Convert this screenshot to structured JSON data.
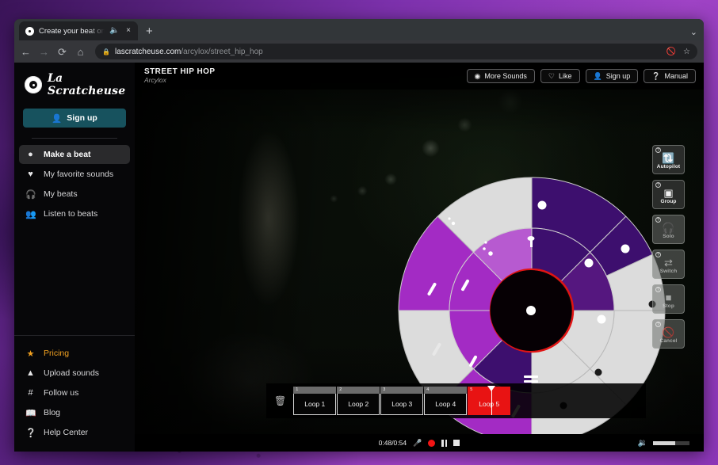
{
  "browser": {
    "tab": {
      "title": "Create your beat on \"Stree",
      "audio_icon": "speaker-icon",
      "close_icon": "×"
    },
    "newtab_label": "+",
    "window_menu_icon": "⌄",
    "nav": {
      "back": "←",
      "forward": "→",
      "reload": "⟳",
      "home": "⌂"
    },
    "omnibox": {
      "lock_icon": "lock-icon",
      "url_domain": "lascratcheuse.com",
      "url_path": "/arcylox/street_hip_hop",
      "incognito_icon": "eye-slash-icon",
      "bookmark_icon": "☆"
    }
  },
  "sidebar": {
    "brand": "La Scratcheuse",
    "signup_label": "Sign up",
    "nav_top": [
      {
        "label": "Make a beat",
        "icon": "disc-icon",
        "active": true
      },
      {
        "label": "My favorite sounds",
        "icon": "heart-icon",
        "active": false
      },
      {
        "label": "My beats",
        "icon": "headphones-icon",
        "active": false
      },
      {
        "label": "Listen to beats",
        "icon": "people-icon",
        "active": false
      }
    ],
    "nav_bottom": [
      {
        "label": "Pricing",
        "icon": "star-icon",
        "highlight": true
      },
      {
        "label": "Upload sounds",
        "icon": "upload-icon",
        "highlight": false
      },
      {
        "label": "Follow us",
        "icon": "hash-icon",
        "highlight": false
      },
      {
        "label": "Blog",
        "icon": "book-icon",
        "highlight": false
      },
      {
        "label": "Help Center",
        "icon": "question-icon",
        "highlight": false
      }
    ]
  },
  "header": {
    "track_title": "STREET HIP HOP",
    "track_author": "Arcylox",
    "buttons": [
      {
        "label": "More Sounds",
        "icon": "disc-icon"
      },
      {
        "label": "Like",
        "icon": "heart-outline-icon"
      },
      {
        "label": "Sign up",
        "icon": "person-icon"
      },
      {
        "label": "Manual",
        "icon": "question-icon"
      }
    ]
  },
  "tools": [
    {
      "label": "Autopilot",
      "icon": "sync-icon",
      "enabled": true,
      "help": "?"
    },
    {
      "label": "Group",
      "icon": "select-icon",
      "enabled": true,
      "help": "?"
    },
    {
      "label": "Solo",
      "icon": "headphones-icon",
      "enabled": false,
      "help": "?"
    },
    {
      "label": "Switch",
      "icon": "swap-icon",
      "enabled": false,
      "help": "?"
    },
    {
      "label": "Stop",
      "icon": "stop-icon",
      "enabled": false,
      "help": "?"
    },
    {
      "label": "Cancel",
      "icon": "ban-icon",
      "enabled": false,
      "help": "?"
    }
  ],
  "wheel": {
    "colors": {
      "dark_purple": "#3d0f6e",
      "mid_purple": "#55177f",
      "bright_purple": "#a32bc4",
      "light_purple": "#b75ad0",
      "light_grey": "#dcdcdc",
      "hub": "#060004",
      "hub_ring": "#e01414"
    },
    "outer_segments": [
      {
        "index": 0,
        "color": "#3d0f6e",
        "marker": "white"
      },
      {
        "index": 1,
        "color": "#3d0f6e",
        "marker": "none"
      },
      {
        "index": 2,
        "color": "#dcdcdc",
        "marker": "white"
      },
      {
        "index": 3,
        "color": "#dcdcdc",
        "marker": "dark"
      },
      {
        "index": 4,
        "color": "#dcdcdc",
        "marker": "dark"
      },
      {
        "index": 5,
        "color": "#dcdcdc",
        "marker": "dark"
      },
      {
        "index": 6,
        "color": "#a32bc4",
        "marker": "slash"
      },
      {
        "index": 7,
        "color": "#dcdcdc",
        "marker": "slash"
      },
      {
        "index": 8,
        "color": "#a32bc4",
        "marker": "slash"
      },
      {
        "index": 9,
        "color": "#dcdcdc",
        "marker": "dots"
      }
    ],
    "inner_segments": [
      {
        "index": 0,
        "color": "#3d0f6e",
        "marker": "pin"
      },
      {
        "index": 1,
        "color": "#55177f",
        "marker": "white"
      },
      {
        "index": 2,
        "color": "#55177f",
        "marker": "white"
      },
      {
        "index": 3,
        "color": "#dcdcdc",
        "marker": "none"
      },
      {
        "index": 4,
        "color": "#3d0f6e",
        "marker": "bars"
      },
      {
        "index": 5,
        "color": "#a32bc4",
        "marker": "slash"
      },
      {
        "index": 6,
        "color": "#a32bc4",
        "marker": "slash"
      },
      {
        "index": 7,
        "color": "#b75ad0",
        "marker": "dots"
      }
    ],
    "center_dot": true
  },
  "loopbar": {
    "trash_icon": "trash-icon",
    "loops": [
      {
        "num": "1",
        "label": "Loop 1",
        "active": false
      },
      {
        "num": "2",
        "label": "Loop 2",
        "active": false
      },
      {
        "num": "3",
        "label": "Loop 3",
        "active": false
      },
      {
        "num": "4",
        "label": "Loop 4",
        "active": false
      },
      {
        "num": "5",
        "label": "Loop 5",
        "active": true
      }
    ]
  },
  "transport": {
    "time": "0:48/0:54",
    "mic_icon": "microphone-icon",
    "record_icon": "record-icon",
    "pause_icon": "pause-icon",
    "stop_icon": "stop-icon",
    "volume_icon": "volume-icon",
    "volume_percent": 60
  }
}
